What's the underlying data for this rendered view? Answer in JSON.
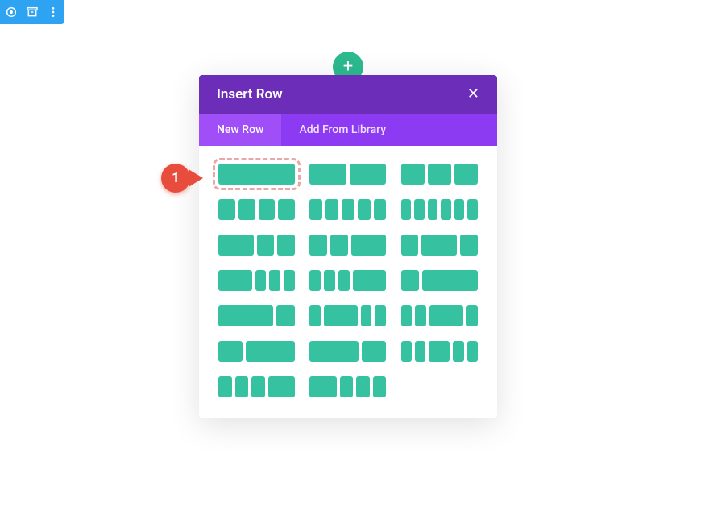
{
  "toolbar": {
    "icons": [
      "target-icon",
      "archive-icon",
      "more-vertical-icon"
    ]
  },
  "add_button": {
    "glyph": "+"
  },
  "modal": {
    "title": "Insert Row",
    "close_glyph": "✕",
    "tabs": [
      {
        "label": "New Row",
        "active": true
      },
      {
        "label": "Add From Library",
        "active": false
      }
    ],
    "layouts": [
      {
        "cols": [
          1
        ],
        "selected": true
      },
      {
        "cols": [
          1,
          1
        ]
      },
      {
        "cols": [
          1,
          1,
          1
        ]
      },
      {
        "cols": [
          1,
          1,
          1,
          1
        ]
      },
      {
        "cols": [
          1,
          1,
          1,
          1,
          1
        ]
      },
      {
        "cols": [
          1,
          1,
          1,
          1,
          1,
          1
        ]
      },
      {
        "cols": [
          2,
          1,
          1
        ]
      },
      {
        "cols": [
          1,
          1,
          2
        ]
      },
      {
        "cols": [
          1,
          2,
          1
        ]
      },
      {
        "cols": [
          3,
          1,
          1,
          1
        ]
      },
      {
        "cols": [
          1,
          1,
          1,
          3
        ]
      },
      {
        "cols": [
          1,
          3
        ]
      },
      {
        "cols": [
          3,
          1
        ]
      },
      {
        "cols": [
          1,
          3,
          1,
          1
        ]
      },
      {
        "cols": [
          1,
          1,
          3,
          1
        ]
      },
      {
        "cols": [
          1,
          2
        ]
      },
      {
        "cols": [
          2,
          1
        ]
      },
      {
        "cols": [
          1,
          1,
          2,
          1,
          1
        ]
      },
      {
        "cols": [
          1,
          1,
          1,
          2
        ]
      },
      {
        "cols": [
          2,
          1,
          1,
          1
        ]
      }
    ]
  },
  "callout": {
    "number": "1"
  },
  "colors": {
    "toolbar_bg": "#2ea3f2",
    "accent_green": "#36c2a0",
    "add_green": "#2cba8f",
    "modal_header": "#6c2eb9",
    "modal_tabs": "#8c3bf2",
    "modal_tab_active": "#a04ef8",
    "callout_red": "#e84c3d",
    "dash_red": "#e8a8a8"
  }
}
